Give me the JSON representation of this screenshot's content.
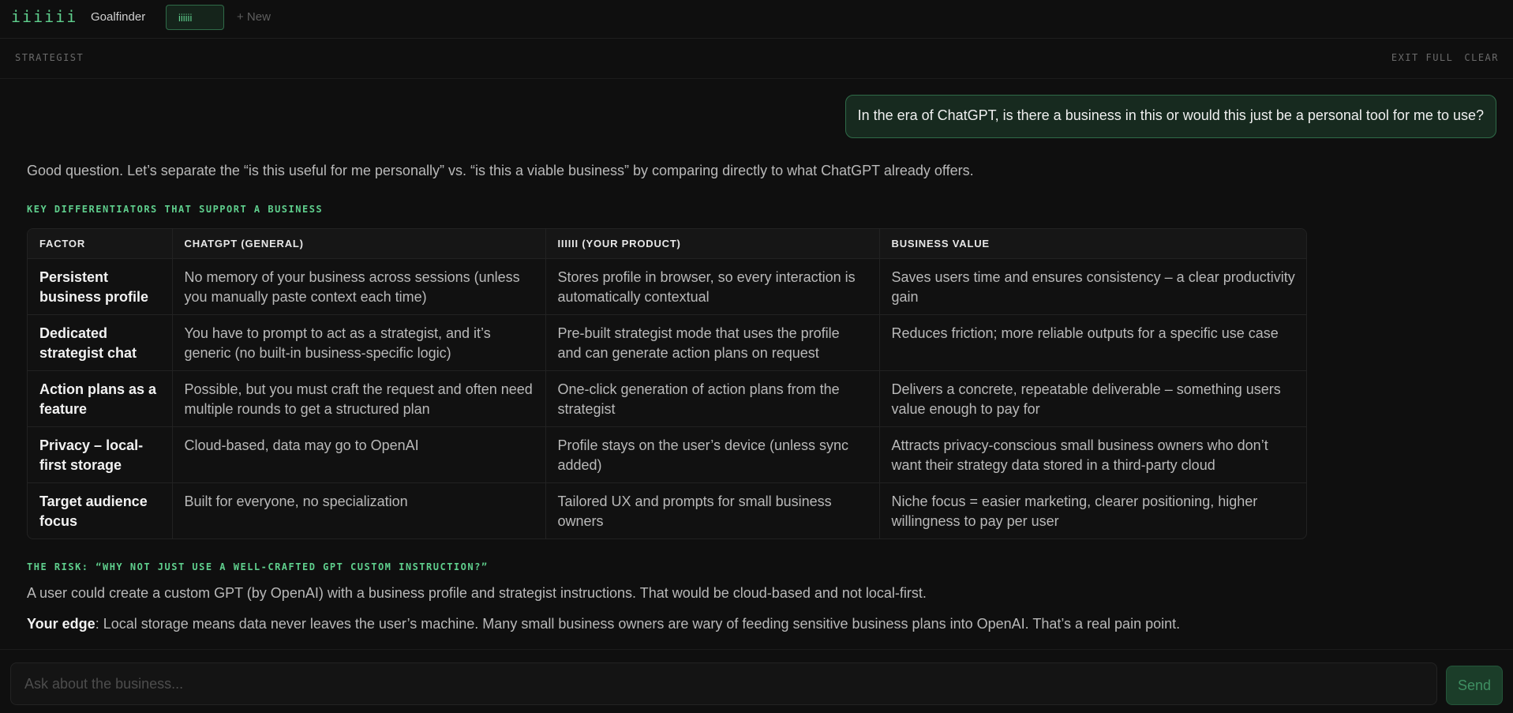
{
  "topbar": {
    "logo": "iiiiii",
    "nav_goalfinder": "Goalfinder",
    "active_tab": "iiiiii",
    "new_label": "+ New"
  },
  "subbar": {
    "title": "STRATEGIST",
    "exit_full": "EXIT FULL",
    "clear": "CLEAR"
  },
  "chat": {
    "user_message": "In the era of ChatGPT, is there a business in this or would this just be a personal tool for me to use?",
    "intro": "Good question. Let’s separate the “is this useful for me personally” vs. “is this a viable business” by comparing directly to what ChatGPT already offers.",
    "section1_heading": "KEY DIFFERENTIATORS THAT SUPPORT A BUSINESS",
    "table": {
      "headers": [
        "FACTOR",
        "CHATGPT (GENERAL)",
        "IIIIII (YOUR PRODUCT)",
        "BUSINESS VALUE"
      ],
      "rows": [
        [
          "Persistent business profile",
          "No memory of your business across sessions (unless you manually paste context each time)",
          "Stores profile in browser, so every interaction is automatically contextual",
          "Saves users time and ensures consistency – a clear productivity gain"
        ],
        [
          "Dedicated strategist chat",
          "You have to prompt to act as a strategist, and it’s generic (no built-in business-specific logic)",
          "Pre-built strategist mode that uses the profile and can generate action plans on request",
          "Reduces friction; more reliable outputs for a specific use case"
        ],
        [
          "Action plans as a feature",
          "Possible, but you must craft the request and often need multiple rounds to get a structured plan",
          "One-click generation of action plans from the strategist",
          "Delivers a concrete, repeatable deliverable – something users value enough to pay for"
        ],
        [
          "Privacy – local-first storage",
          "Cloud-based, data may go to OpenAI",
          "Profile stays on the user’s device (unless sync added)",
          "Attracts privacy-conscious small business owners who don’t want their strategy data stored in a third-party cloud"
        ],
        [
          "Target audience focus",
          "Built for everyone, no specialization",
          "Tailored UX and prompts for small business owners",
          "Niche focus = easier marketing, clearer positioning, higher willingness to pay per user"
        ]
      ]
    },
    "section2_heading": "THE RISK: “WHY NOT JUST USE A WELL-CRAFTED GPT CUSTOM INSTRUCTION?”",
    "risk_paragraph": "A user could create a custom GPT (by OpenAI) with a business profile and strategist instructions. That would be cloud-based and not local-first.",
    "edge_label": "Your edge",
    "edge_text": ": Local storage means data never leaves the user’s machine. Many small business owners are wary of feeding sensitive business plans into OpenAI. That’s a real pain point."
  },
  "input": {
    "placeholder": "Ask about the business...",
    "value": "",
    "send_label": "Send"
  }
}
